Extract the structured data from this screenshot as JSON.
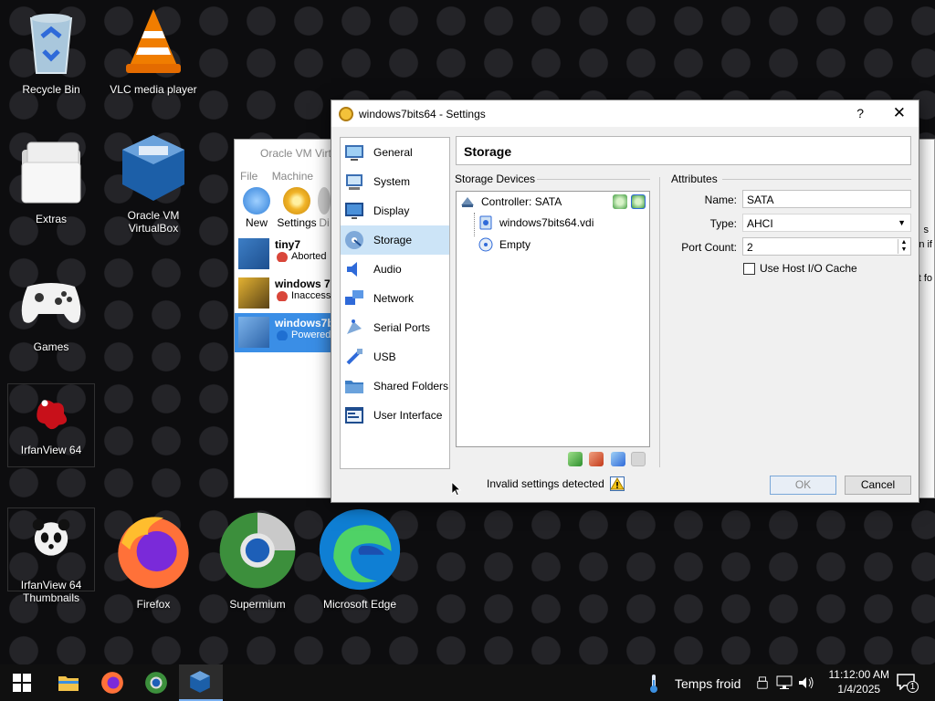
{
  "desktop": {
    "icons": [
      {
        "label": "Recycle Bin"
      },
      {
        "label": "VLC media player"
      },
      {
        "label": "Extras"
      },
      {
        "label": "Oracle VM\nVirtualBox"
      },
      {
        "label": "Games"
      },
      {
        "label": "IrfanView 64"
      },
      {
        "label": "IrfanView 64\nThumbnails"
      },
      {
        "label": "Firefox"
      },
      {
        "label": "Supermium"
      },
      {
        "label": "Microsoft Edge"
      }
    ]
  },
  "manager": {
    "title": "Oracle VM Virt",
    "menu": [
      "File",
      "Machine"
    ],
    "tools": [
      "New",
      "Settings",
      "Di"
    ],
    "vms": [
      {
        "name": "tiny7",
        "state": "Aborted",
        "state_color": "#d9463a"
      },
      {
        "name": "windows 7",
        "state": "Inaccess",
        "state_color": "#d9463a"
      },
      {
        "name": "windows7b",
        "state": "Powered",
        "state_color": "#1f6fd1"
      }
    ],
    "right_fragments": [
      "s",
      "n if",
      "t fo"
    ]
  },
  "dialog": {
    "title": "windows7bits64 - Settings",
    "help": "?",
    "close": "✕",
    "categories": [
      {
        "label": "General",
        "icon": "general-icon"
      },
      {
        "label": "System",
        "icon": "system-icon"
      },
      {
        "label": "Display",
        "icon": "display-icon"
      },
      {
        "label": "Storage",
        "icon": "storage-icon"
      },
      {
        "label": "Audio",
        "icon": "audio-icon"
      },
      {
        "label": "Network",
        "icon": "network-icon"
      },
      {
        "label": "Serial Ports",
        "icon": "serial-ports-icon"
      },
      {
        "label": "USB",
        "icon": "usb-icon"
      },
      {
        "label": "Shared Folders",
        "icon": "shared-folders-icon"
      },
      {
        "label": "User Interface",
        "icon": "user-interface-icon"
      }
    ],
    "selected_category": "Storage",
    "page_header": "Storage",
    "storage_devices_label": "Storage Devices",
    "controller": "Controller: SATA",
    "disk": "windows7bits64.vdi",
    "optical": "Empty",
    "attributes_label": "Attributes",
    "name_label": "Name:",
    "name_value": "SATA",
    "type_label": "Type:",
    "type_value": "AHCI",
    "port_count_label": "Port Count:",
    "port_count_value": "2",
    "host_cache_label": "Use Host I/O Cache",
    "host_cache_checked": false,
    "status": "Invalid settings detected",
    "ok": "OK",
    "cancel": "Cancel"
  },
  "taskbar": {
    "weather": "Temps froid",
    "time": "11:12:00 AM",
    "date": "1/4/2025",
    "notifications": "1"
  }
}
